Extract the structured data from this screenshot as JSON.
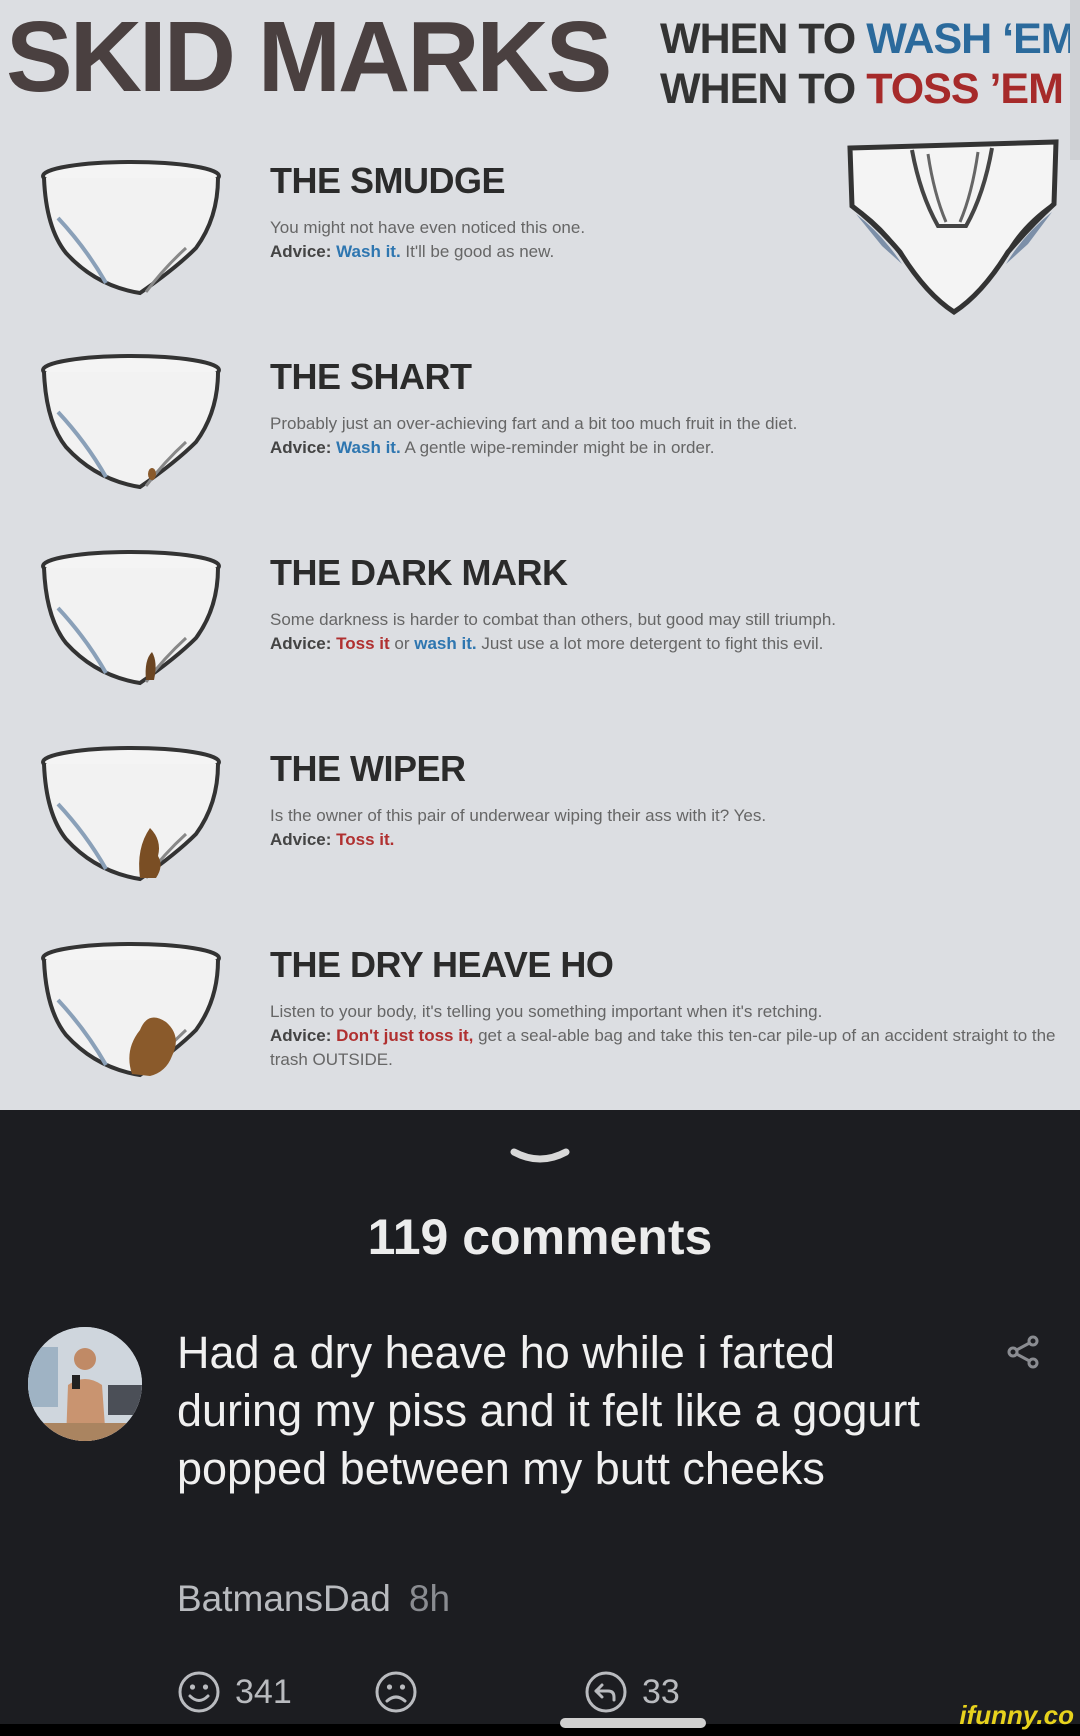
{
  "infographic": {
    "title": "SKID MARKS",
    "subtitle_line1_prefix": "WHEN TO ",
    "subtitle_line1_accent": "WASH ‘EM,",
    "subtitle_line2_prefix": "WHEN TO ",
    "subtitle_line2_accent": "TOSS ’EM",
    "colors": {
      "wash": "#2e76b0",
      "toss": "#b03030",
      "stain": "#8a5a2b"
    },
    "entries": [
      {
        "heading": "THE SMUDGE",
        "desc": "You might not have even noticed this one.",
        "advice_label": "Advice: ",
        "advice_action": "Wash it.",
        "advice_action_type": "wash",
        "advice_rest": " It'll be good as new."
      },
      {
        "heading": "THE SHART",
        "desc": "Probably just an over-achieving fart and a bit too much fruit in the diet.",
        "advice_label": "Advice: ",
        "advice_action": "Wash it.",
        "advice_action_type": "wash",
        "advice_rest": " A gentle wipe-reminder might be in order."
      },
      {
        "heading": "THE DARK MARK",
        "desc": "Some darkness is harder to combat than others, but good may still triumph.",
        "advice_label": "Advice: ",
        "advice_action": "Toss it",
        "advice_action_type": "toss",
        "advice_mid": " or ",
        "advice_action2": "wash it.",
        "advice_rest": " Just use a lot more detergent to fight this evil."
      },
      {
        "heading": "THE WIPER",
        "desc": "Is the owner of this pair of underwear wiping their ass with it? Yes.",
        "advice_label": "Advice: ",
        "advice_action": "Toss it.",
        "advice_action_type": "toss",
        "advice_rest": ""
      },
      {
        "heading": "THE DRY HEAVE HO",
        "desc": "Listen to your body, it's telling you something important when it's retching.",
        "advice_label": "Advice: ",
        "advice_action": "Don't just toss it,",
        "advice_action_type": "toss",
        "advice_rest": " get a seal-able bag and take this ten-car pile-up of an accident straight to the trash OUTSIDE."
      }
    ]
  },
  "comments": {
    "count_label": "119 comments",
    "items": [
      {
        "text": "Had a dry heave ho while i farted during my piss and it felt like a gogurt popped between my butt cheeks",
        "author": "BatmansDad",
        "time": "8h",
        "smiles": "341",
        "replies": "33"
      }
    ]
  },
  "icons": {
    "collapse": "chevron-down-icon",
    "share": "share-icon",
    "smile": "smile-icon",
    "frown": "frown-icon",
    "reply": "reply-icon"
  },
  "watermark": "ifunny.co"
}
